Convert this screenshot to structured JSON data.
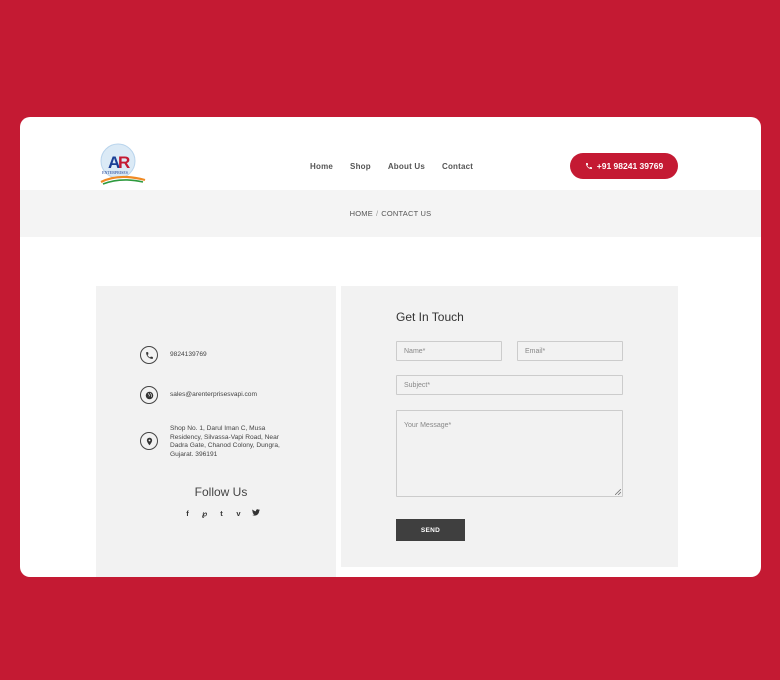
{
  "brand": {
    "logo_text": "AR",
    "logo_subtext": "ENTERPRISES",
    "accent_color": "#c41a33"
  },
  "nav": {
    "items": [
      {
        "label": "Home"
      },
      {
        "label": "Shop"
      },
      {
        "label": "About Us"
      },
      {
        "label": "Contact"
      }
    ],
    "phone_button": "+91 98241 39769"
  },
  "breadcrumb": {
    "home": "HOME",
    "separator": "/",
    "current": "CONTACT US"
  },
  "contact_info": {
    "phone": "9824139769",
    "email": "sales@arenterprisesvapi.com",
    "address": "Shop No. 1, Darul Iman C, Musa Residency, Silvassa-Vapi Road, Near Dadra Gate, Chanod Colony, Dungra, Gujarat. 396191",
    "icons": [
      "phone-icon",
      "globe-icon",
      "location-icon"
    ]
  },
  "follow": {
    "title": "Follow Us",
    "icons": [
      "facebook-icon",
      "pinterest-icon",
      "tumblr-icon",
      "vimeo-icon",
      "twitter-icon"
    ]
  },
  "form": {
    "title": "Get In Touch",
    "name_placeholder": "Name*",
    "email_placeholder": "Email*",
    "subject_placeholder": "Subject*",
    "message_placeholder": "Your Message*",
    "send_label": "SEND"
  }
}
